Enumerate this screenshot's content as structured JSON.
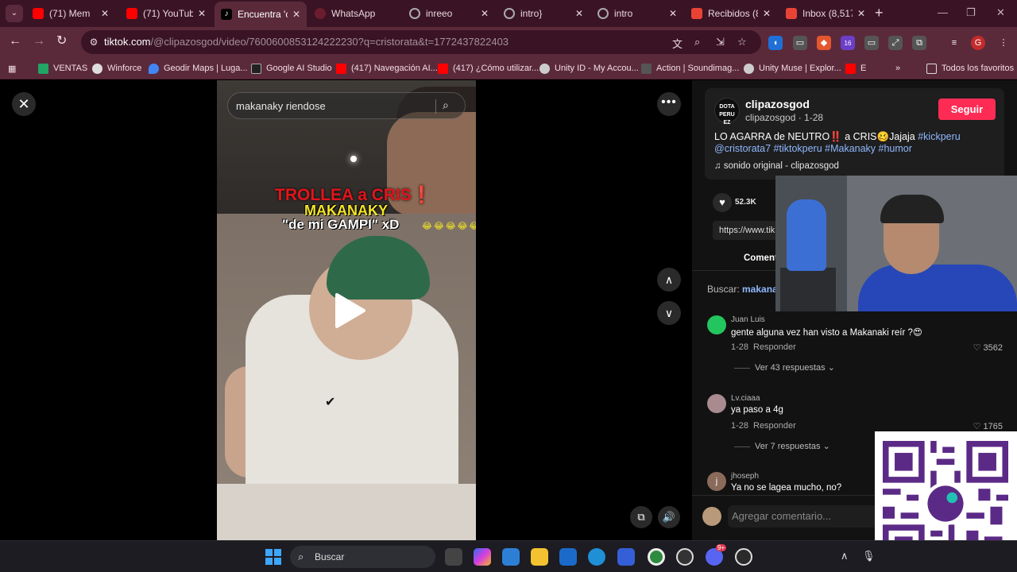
{
  "browser": {
    "tabs": [
      {
        "title": "(71) Mem",
        "favicon_color": "#ff0000"
      },
      {
        "title": "(71) YouTube",
        "favicon_color": "#ff0000"
      },
      {
        "title": "Encuentra 'cr",
        "favicon_color": "#000000",
        "active": true
      },
      {
        "title": "WhatsApp",
        "favicon_color": "#6b1d2e"
      },
      {
        "title": "inreeo",
        "favicon_color": "#888888"
      },
      {
        "title": "intro}",
        "favicon_color": "#888888"
      },
      {
        "title": "intro",
        "favicon_color": "#888888"
      },
      {
        "title": "Recibidos (8,6",
        "favicon_color": "#ea4335"
      },
      {
        "title": "Inbox (8,517",
        "favicon_color": "#ea4335"
      }
    ],
    "url_host": "tiktok.com",
    "url_path": "/@clipazosgod/video/7600600853124222230?q=cristorata&t=1772437822403",
    "ext_badge": "16",
    "profile_initial": "G",
    "bookmarks": [
      {
        "label": "VENTAS",
        "color": "#21a464"
      },
      {
        "label": "Winforce",
        "color": "#dddddd"
      },
      {
        "label": "Geodir Maps | Luga...",
        "color": "#4285f4"
      },
      {
        "label": "Google AI Studio",
        "color": "#222222"
      },
      {
        "label": "(417) Navegación AI...",
        "color": "#ff0000"
      },
      {
        "label": "(417) ¿Cómo utilizar...",
        "color": "#ff0000"
      },
      {
        "label": "Unity ID - My Accou...",
        "color": "#cccccc"
      },
      {
        "label": "Action | Soundimag...",
        "color": "#555555"
      },
      {
        "label": "Unity Muse | Explor...",
        "color": "#cccccc"
      },
      {
        "label": "E",
        "color": "#ff0000"
      }
    ],
    "all_bookmarks": "Todos los favoritos"
  },
  "video": {
    "search_text": "makanaky riendose",
    "caption_red": "TROLLEA a CRIS❗",
    "caption_yellow": "MAKANAKY",
    "caption_white": "\"de mi GAMPI\" xD",
    "caption_emojis": "😂😂😂😂😂"
  },
  "post": {
    "avatar_text": "DOTA PERU EZ",
    "author": "clipazosgod",
    "author_sub": "clipazosgod · 1-28",
    "follow_label": "Seguir",
    "caption_text": "LO AGARRA de NEUTRO‼️ a CRIS🥴Jajaja ",
    "caption_tags_1": "#kickperu",
    "caption_tags_2": "@cristorata7 #tiktokperu #Makanaky #humor",
    "sound": "♫  sonido original - clipazosgod",
    "likes": "52.3K",
    "link": "https://www.tik",
    "comments_tab": "Comentarios",
    "search_label": "Buscar: ",
    "search_query": "makanaky"
  },
  "comments": [
    {
      "user": "Juan Luis",
      "text": "gente alguna vez han visto a Makanaki reír ?😍",
      "date": "1-28",
      "reply": "Responder",
      "likes": "3562",
      "more": "Ver 43 respuestas ⌄",
      "avatar_color": "#22c55e"
    },
    {
      "user": "Lv.ciaaa",
      "text": "ya paso a 4g",
      "date": "1-28",
      "reply": "Responder",
      "likes": "1765",
      "more": "Ver 7 respuestas ⌄",
      "avatar_color": "#a88a8f"
    },
    {
      "user": "jhoseph",
      "text": "Ya no se lagea mucho, no?",
      "date": "",
      "reply": "",
      "likes": "",
      "more": "",
      "avatar_color": "#8a6a5a"
    }
  ],
  "add_comment_placeholder": "Agregar comentario...",
  "taskbar": {
    "search_label": "Buscar",
    "discord_badge": "9+"
  }
}
